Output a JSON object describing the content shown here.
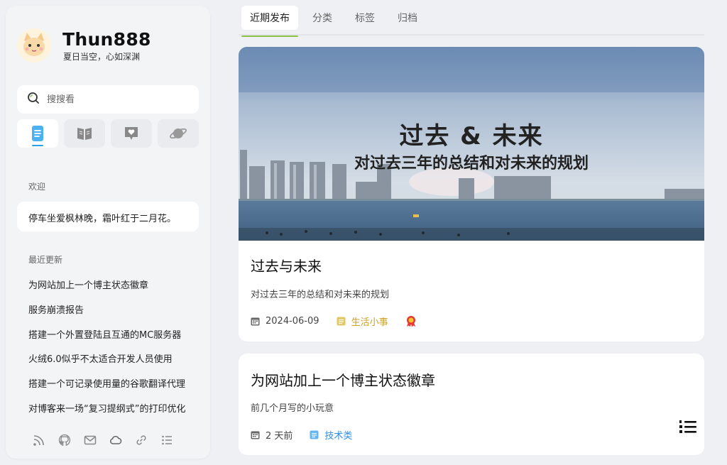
{
  "profile": {
    "name": "Thun888",
    "tagline": "夏日当空，心如深渊"
  },
  "search": {
    "placeholder": "搜搜看"
  },
  "sidebar_tabs": [
    {
      "icon": "document-icon",
      "active": true
    },
    {
      "icon": "book-icon",
      "active": false
    },
    {
      "icon": "heart-chat-icon",
      "active": false
    },
    {
      "icon": "planet-icon",
      "active": false
    }
  ],
  "welcome": {
    "label": "欢迎",
    "text": "停车坐爱枫林晚，霜叶红于二月花。"
  },
  "recent": {
    "label": "最近更新",
    "items": [
      "为网站加上一个博主状态徽章",
      "服务崩溃报告",
      "搭建一个外置登陆且互通的MC服务器",
      "火绒6.0似乎不太适合开发人员使用",
      "搭建一个可记录使用量的谷歌翻译代理",
      "对博客来一场“复习提纲式”的打印优化"
    ]
  },
  "social_icons": [
    "rss-icon",
    "github-icon",
    "mail-icon",
    "cloud-icon",
    "link-icon",
    "list-icon"
  ],
  "main_tabs": [
    "近期发布",
    "分类",
    "标签",
    "归档"
  ],
  "posts": [
    {
      "banner_title": "过去 & 未来",
      "banner_subtitle": "对过去三年的总结和对未来的规划",
      "title": "过去与未来",
      "desc": "对过去三年的总结和对未来的规划",
      "date": "2024-06-09",
      "category": "生活小事",
      "category_color": "#c9a227",
      "badge_icon": "award-icon"
    },
    {
      "title": "为网站加上一个博主状态徽章",
      "desc": "前几个月写的小玩意",
      "date": "2 天前",
      "category": "技术类",
      "category_color": "#2f8fe0"
    }
  ],
  "colors": {
    "accent_tab": "#29a0e8",
    "accent_main_tab": "#8bc34a"
  }
}
